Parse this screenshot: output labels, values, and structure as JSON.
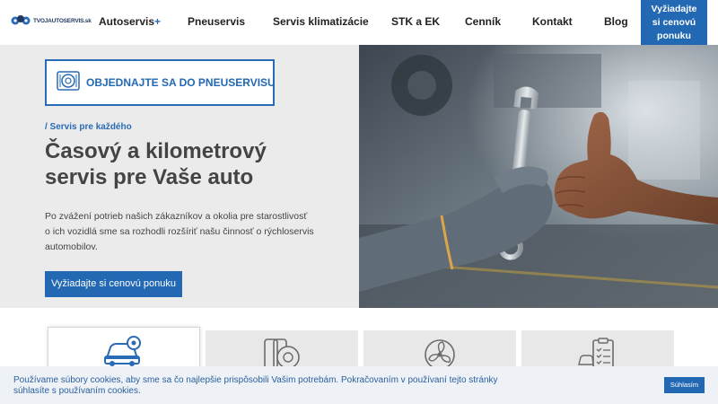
{
  "header": {
    "logo_text": "TVOJAUTOSERVIS.sk",
    "nav": [
      {
        "label": "Autoservis",
        "plus": "+"
      },
      {
        "label": "Pneuservis"
      },
      {
        "label": "Servis klimatizácie"
      },
      {
        "label": "STK a EK"
      },
      {
        "label": "Cenník"
      },
      {
        "label": "Kontakt"
      },
      {
        "label": "Blog"
      }
    ],
    "cta_lines": [
      "Vyžiadajte",
      "si cenovú",
      "ponuku"
    ]
  },
  "hero": {
    "booking_label": "OBJEDNAJTE SA DO PNEUSERVISU",
    "eyebrow": "/ Servis pre každého",
    "title_lines": [
      "Časový a kilometrový",
      "servis pre Vaše auto"
    ],
    "text_lines": [
      "Po zvážení potrieb našich zákazníkov a okolia pre starostlivosť",
      "o ich vozidlá sme sa rozhodli rozšíriť našu činnosť o rýchloservis",
      "automobilov."
    ],
    "button_label": "Vyžiadajte si cenovú ponuku"
  },
  "service_cards": [
    {
      "icon": "car-service-icon",
      "active": true
    },
    {
      "icon": "tire-icon",
      "active": false
    },
    {
      "icon": "fan-icon",
      "active": false
    },
    {
      "icon": "inspection-checklist-icon",
      "active": false
    }
  ],
  "cookie": {
    "text_lines": [
      "Používame súbory cookies, aby sme sa čo najlepšie prispôsobili Vašim potrebám. Pokračovaním v používaní tejto stránky",
      "súhlasíte s používaním cookies."
    ],
    "accept_label": "Súhlasím"
  },
  "colors": {
    "accent": "#2268b2",
    "hero_bg": "#ebebeb",
    "cookie_bg": "#eef2f7"
  }
}
